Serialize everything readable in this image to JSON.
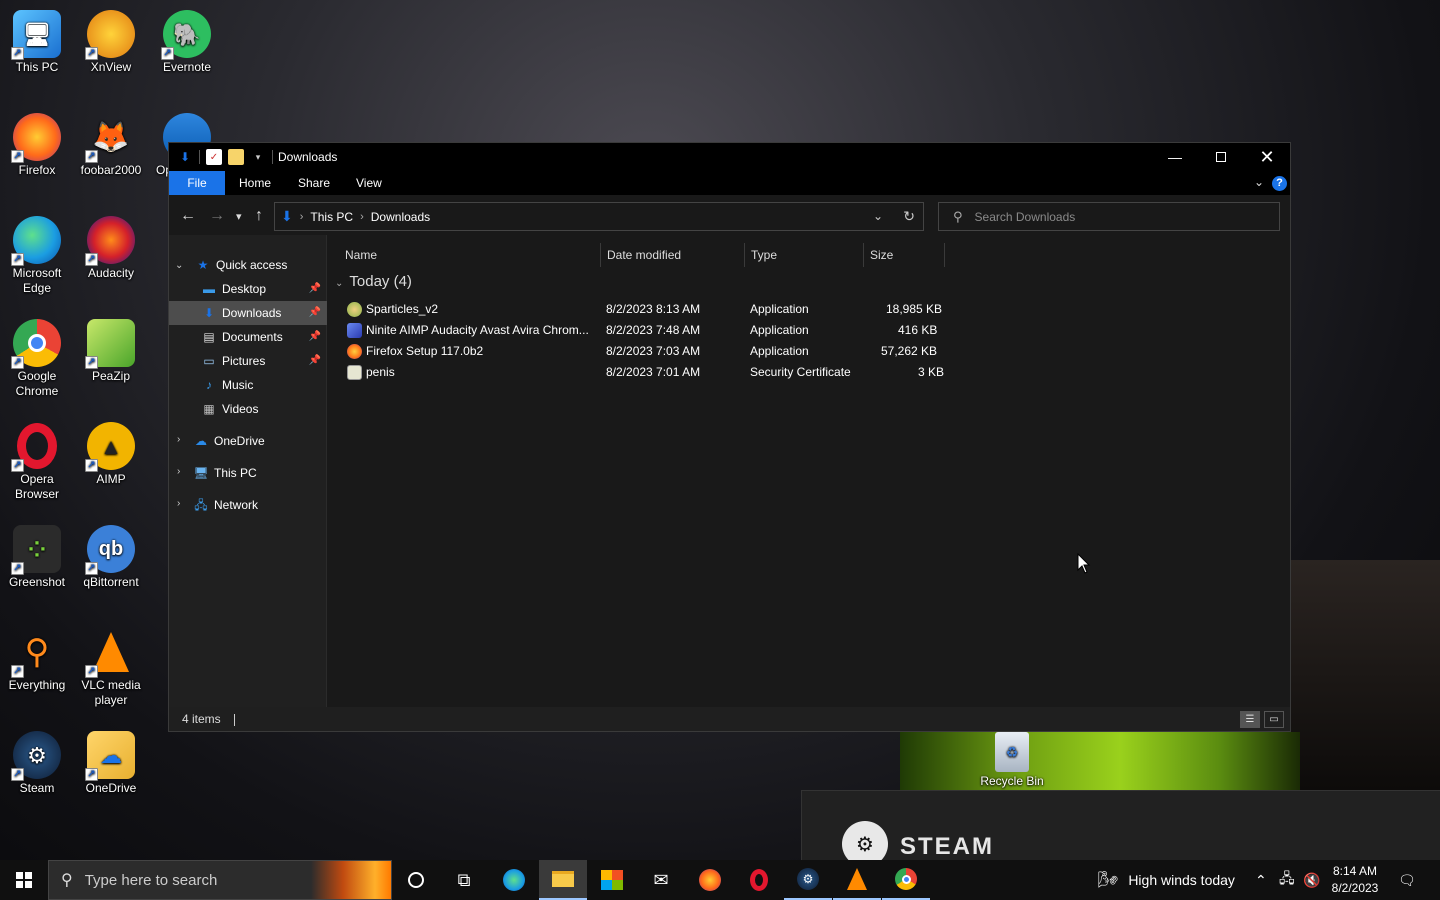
{
  "desktop": {
    "icons": [
      {
        "label": "This PC"
      },
      {
        "label": "XnView"
      },
      {
        "label": "Evernote"
      },
      {
        "label": "Firefox"
      },
      {
        "label": "foobar2000"
      },
      {
        "label": "Op"
      },
      {
        "label": "Microsoft Edge"
      },
      {
        "label": "Audacity"
      },
      {
        "label": "Google Chrome"
      },
      {
        "label": "PeaZip"
      },
      {
        "label": "Opera Browser"
      },
      {
        "label": "AIMP"
      },
      {
        "label": "Greenshot"
      },
      {
        "label": "qBittorrent"
      },
      {
        "label": "Everything"
      },
      {
        "label": "VLC media player"
      },
      {
        "label": "Steam"
      },
      {
        "label": "OneDrive"
      },
      {
        "label": "Recycle Bin"
      }
    ]
  },
  "explorer": {
    "title": "Downloads",
    "ribbon_tabs": {
      "file": "File",
      "home": "Home",
      "share": "Share",
      "view": "View"
    },
    "help": "?",
    "breadcrumb": {
      "root": "This PC",
      "current": "Downloads"
    },
    "search_placeholder": "Search Downloads",
    "nav": {
      "quick_access": "Quick access",
      "desktop": "Desktop",
      "downloads": "Downloads",
      "documents": "Documents",
      "pictures": "Pictures",
      "music": "Music",
      "videos": "Videos",
      "onedrive": "OneDrive",
      "this_pc": "This PC",
      "network": "Network"
    },
    "columns": {
      "name": "Name",
      "date": "Date modified",
      "type": "Type",
      "size": "Size"
    },
    "group": "Today (4)",
    "files": [
      {
        "name": "Sparticles_v2",
        "date": "8/2/2023 8:13 AM",
        "type": "Application",
        "size": "18,985 KB",
        "icon_color": "#8ab34a"
      },
      {
        "name": "Ninite AIMP Audacity Avast Avira Chrom...",
        "date": "8/2/2023 7:48 AM",
        "type": "Application",
        "size": "416 KB",
        "icon_color": "#3b5bd8"
      },
      {
        "name": "Firefox Setup 117.0b2",
        "date": "8/2/2023 7:03 AM",
        "type": "Application",
        "size": "57,262 KB",
        "icon_color": "#ff8a1c"
      },
      {
        "name": "penis",
        "date": "8/2/2023 7:01 AM",
        "type": "Security Certificate",
        "size": "3 KB",
        "icon_color": "#d8d8c0"
      }
    ],
    "status": "4 items"
  },
  "steam_popup": {
    "brand": "STEAM"
  },
  "taskbar": {
    "search_placeholder": "Type here to search",
    "weather": "High winds today",
    "time": "8:14 AM",
    "date": "8/2/2023"
  }
}
